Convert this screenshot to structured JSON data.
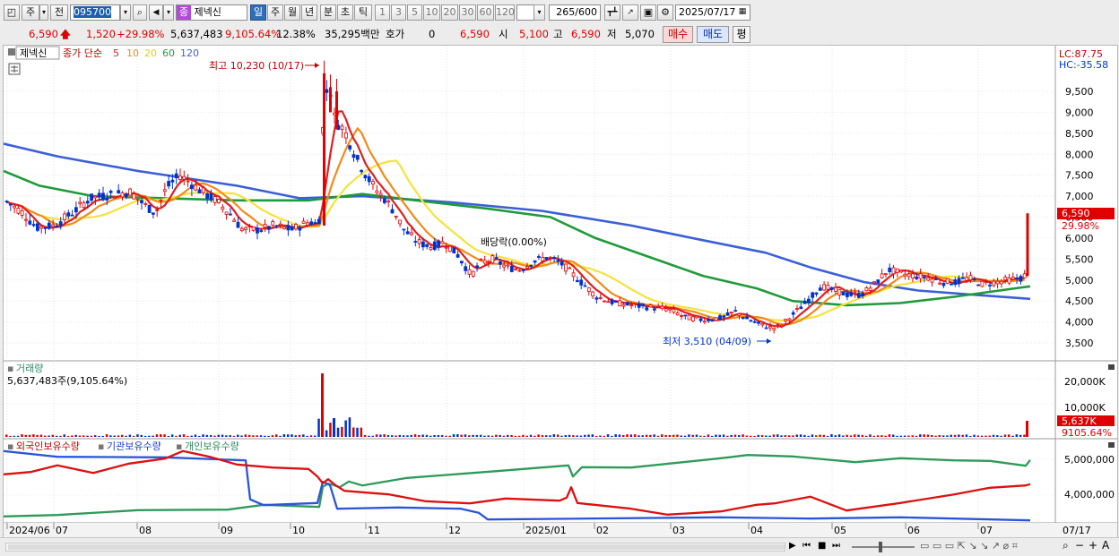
{
  "toolbar": {
    "period_label": "주",
    "prev_label": "전",
    "code": "095700",
    "stock_name": "제넥신",
    "badge": "종",
    "periods": [
      "일",
      "주",
      "월",
      "년",
      "분",
      "초",
      "틱"
    ],
    "ticks": [
      "1",
      "3",
      "5",
      "10",
      "20",
      "30",
      "60",
      "120"
    ],
    "count": "265",
    "count_total": "/600",
    "date": "2025/07/17"
  },
  "quote": {
    "price": "6,590",
    "change": "1,520",
    "change_pct": "+29.98%",
    "volume": "5,637,483",
    "volume_pct": "9,105.64%",
    "turnover": "12.38%",
    "amount": "35,295백만",
    "hoga_label": "호가",
    "hoga_value": "0",
    "price2": "6,590",
    "open_label": "시",
    "open_value": "5,100",
    "high_label": "고",
    "high_value": "6,590",
    "low_label": "저",
    "low_value": "5,070",
    "buy_label": "매수",
    "sell_label": "매도",
    "eval_label": "평"
  },
  "price_panel": {
    "stock_tag": "제넥신",
    "legend_title": "종가 단순",
    "ma_periods": [
      "5",
      "10",
      "20",
      "60",
      "120"
    ],
    "lc": "LC:87.75",
    "hc": "HC:-35.58",
    "high_annotation": "최고 10,230 (10/17)",
    "low_annotation": "최저 3,510 (04/09)",
    "dividend_annotation": "배당락(0.00%)",
    "last_price_tag": "6,590",
    "last_pct_tag": "29.98%",
    "y_ticks": [
      "9,500",
      "9,000",
      "8,500",
      "8,000",
      "7,500",
      "7,000",
      "6,500",
      "6,000",
      "5,500",
      "5,000",
      "4,500",
      "4,000",
      "3,500"
    ]
  },
  "volume_panel": {
    "title": "거래량",
    "value": "5,637,483주(9,105.64%)",
    "y_ticks": [
      "20,000K",
      "10,000K"
    ],
    "last_tag": "5,637K",
    "last_pct": "9105.64%"
  },
  "holding_panel": {
    "legend": [
      "외국인보유수량",
      "기관보유수량",
      "개인보유수량"
    ],
    "y_ticks": [
      "5,000,000",
      "4,000,000"
    ]
  },
  "x_axis": {
    "labels": [
      "2024/06",
      "07",
      "08",
      "09",
      "10",
      "11",
      "12",
      "2025/01",
      "02",
      "03",
      "04",
      "05",
      "06",
      "07"
    ],
    "end_label": "07/17"
  },
  "colors": {
    "candle_up": "#e00000",
    "candle_down": "#0033cc",
    "ma5": "#dd2020",
    "ma10": "#f28a1a",
    "ma20": "#f5e23a",
    "ma60": "#1f9a3a",
    "ma120": "#3b5fd6",
    "foreign": "#dd1010",
    "institution": "#2a55d8",
    "individual": "#2e9a5a"
  },
  "chart_data": {
    "type": "line",
    "title": "제넥신 종가 단순 5 10 20 60 120",
    "x": [
      "2024/06",
      "07",
      "08",
      "09",
      "10",
      "11",
      "12",
      "2025/01",
      "02",
      "03",
      "04",
      "05",
      "06",
      "07"
    ],
    "series": [
      {
        "name": "종가",
        "values": [
          6900,
          6500,
          7000,
          6600,
          6300,
          7900,
          5900,
          5400,
          4700,
          4200,
          4300,
          4950,
          5050,
          6590
        ]
      },
      {
        "name": "120",
        "values": [
          8250,
          7850,
          7500,
          7200,
          6900,
          7000,
          6850,
          6700,
          6350,
          6000,
          5650,
          5000,
          4800,
          4550
        ]
      }
    ],
    "ylim": [
      3500,
      10000
    ],
    "annotations": [
      "최고 10,230 (10/17)",
      "최저 3,510 (04/09)",
      "배당락(0.00%)"
    ]
  }
}
